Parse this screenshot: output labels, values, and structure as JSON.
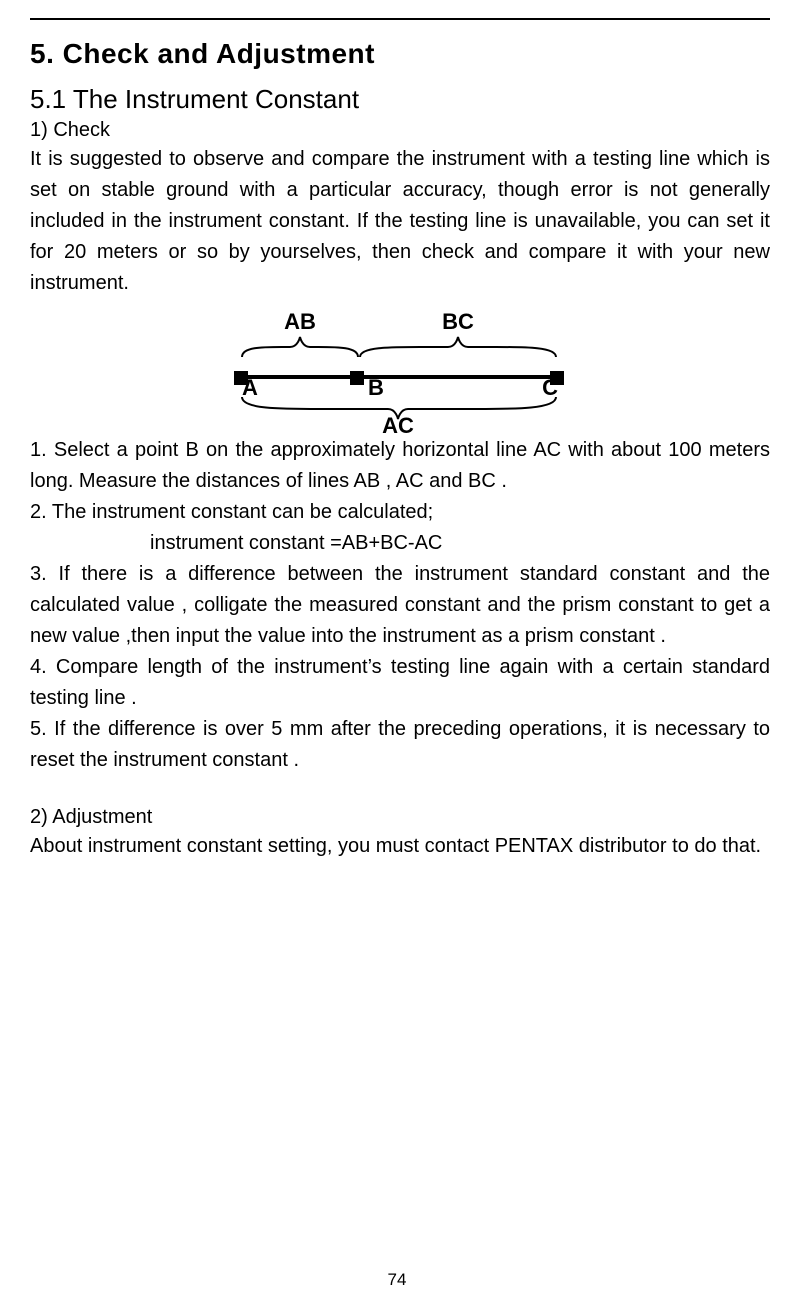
{
  "page_number": "74",
  "h1": "5. Check and Adjustment",
  "h2": "5.1 The Instrument Constant",
  "check_label": "1) Check",
  "intro": "It is suggested to observe and compare the instrument with a testing line which is set on stable ground with a particular accuracy, though error is not generally included in the instrument constant. If the testing line is unavailable, you can set it for 20 meters or so by yourselves, then check and compare it with your new instrument.",
  "diagram": {
    "ab": "AB",
    "bc": "BC",
    "a": "A",
    "b": "B",
    "c": "C",
    "ac": "AC"
  },
  "step1": "1. Select a point B on the approximately horizontal line AC with about 100 meters long. Measure the distances of lines AB , AC and BC .",
  "step2": "2. The instrument constant can be calculated;",
  "formula": "instrument constant =AB+BC-AC",
  "step3": "3. If there is a difference between the instrument standard constant and the calculated value , colligate the measured constant and the prism constant to get a new value ,then input the value into the instrument as a prism constant .",
  "step4": "4. Compare length of the instrument’s testing line again with a certain standard testing line .",
  "step5": "5. If the difference is over 5 mm after the preceding operations, it is necessary to reset the instrument constant .",
  "adjust_label": "2) Adjustment",
  "adjust_text": "About instrument constant setting, you must contact PENTAX distributor to do that."
}
